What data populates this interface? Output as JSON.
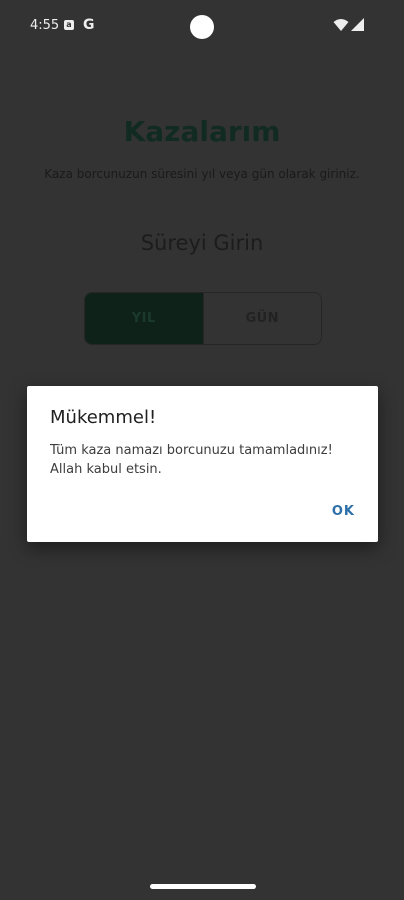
{
  "status_bar": {
    "time": "4:55",
    "notification_icon": "a",
    "google_icon": "G"
  },
  "app": {
    "title": "Kazalarım",
    "subtitle": "Kaza borcunuzun süresini yıl veya gün olarak giriniz.",
    "section_heading": "Süreyi Girin",
    "segments": [
      {
        "label": "YIL",
        "selected": true
      },
      {
        "label": "GÜN",
        "selected": false
      }
    ]
  },
  "dialog": {
    "title": "Mükemmel!",
    "message": "Tüm kaza namazı borcunuzu tamamladınız! Allah kabul etsin.",
    "ok_label": "OK"
  },
  "colors": {
    "scrim_background": "#333333",
    "dialog_background": "#ffffff",
    "accent_button": "#2d6fa8",
    "selected_segment": "#0f2219"
  },
  "icons": {
    "wifi": "wifi-icon",
    "signal": "signal-icon",
    "camera": "camera-cutout"
  }
}
